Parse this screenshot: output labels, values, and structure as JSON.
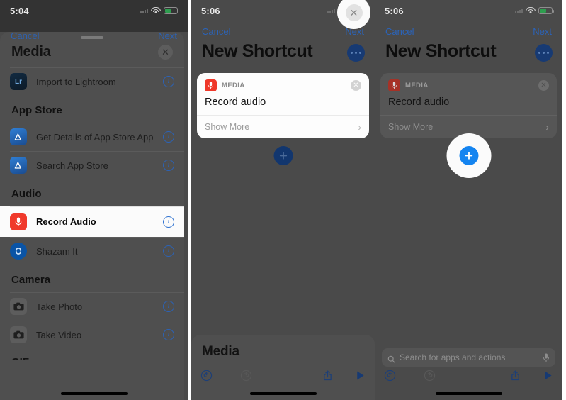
{
  "panels": [
    {
      "id": "panel-action-picker",
      "status": {
        "time": "5:04"
      },
      "nav": {
        "cancel": "Cancel",
        "next": "Next"
      },
      "sheet": {
        "title": "Media",
        "close_label": "✕",
        "sections": [
          {
            "header": "",
            "rows": [
              {
                "label": "Import to Lightroom",
                "icon": "lightroom-icon",
                "info": "i"
              }
            ]
          },
          {
            "header": "App Store",
            "rows": [
              {
                "label": "Get Details of App Store App",
                "icon": "app-store-icon",
                "info": "i"
              },
              {
                "label": "Search App Store",
                "icon": "app-store-icon",
                "info": "i"
              }
            ]
          },
          {
            "header": "Audio",
            "rows": [
              {
                "label": "Record Audio",
                "icon": "microphone-icon",
                "info": "i",
                "selected": true
              },
              {
                "label": "Shazam It",
                "icon": "shazam-icon",
                "info": "i"
              }
            ]
          },
          {
            "header": "Camera",
            "rows": [
              {
                "label": "Take Photo",
                "icon": "camera-icon",
                "info": "i"
              },
              {
                "label": "Take Video",
                "icon": "camera-icon",
                "info": "i"
              }
            ]
          }
        ],
        "next_section_peek": "GIF"
      }
    },
    {
      "id": "panel-new-shortcut",
      "status": {
        "time": "5:06"
      },
      "nav": {
        "cancel": "Cancel",
        "next": "Next"
      },
      "title": "New Shortcut",
      "more_label": "•••",
      "card": {
        "category": "MEDIA",
        "category_icon": "microphone-icon",
        "action": "Record audio",
        "show_more": "Show More",
        "close_label": "✕",
        "chevron": "›"
      },
      "add_button": {
        "label": "+",
        "name": "add-action-button"
      },
      "bottom_sheet": {
        "title": "Media",
        "close_label": "✕"
      },
      "toolbar": {
        "undo": "undo-icon",
        "redo": "redo-icon",
        "share": "share-icon",
        "play": "play-icon"
      }
    },
    {
      "id": "panel-new-shortcut-highlighted",
      "status": {
        "time": "5:06"
      },
      "nav": {
        "cancel": "Cancel",
        "next": "Next"
      },
      "title": "New Shortcut",
      "more_label": "•••",
      "card": {
        "category": "MEDIA",
        "category_icon": "microphone-icon",
        "action": "Record audio",
        "show_more": "Show More",
        "close_label": "✕",
        "chevron": "›"
      },
      "add_button": {
        "label": "+",
        "name": "add-action-button-highlighted"
      },
      "search": {
        "placeholder": "Search for apps and actions",
        "value": ""
      },
      "toolbar": {
        "undo": "undo-icon",
        "redo": "redo-icon",
        "share": "share-icon",
        "play": "play-icon"
      }
    }
  ],
  "colors": {
    "dim_overlay": "#4a4a4a",
    "sheet_bg": "#4f4f4f",
    "accent_blue": "#1484f0",
    "nav_blue": "#2b63b8",
    "record_red": "#f0392b",
    "card_white": "#fdfdfd"
  }
}
